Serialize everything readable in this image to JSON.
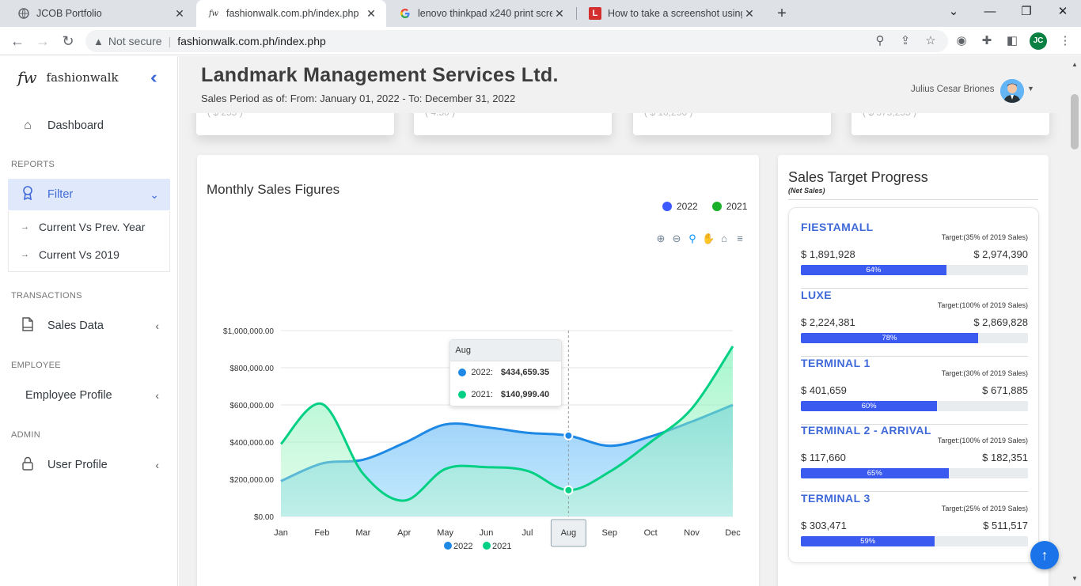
{
  "browser": {
    "tabs": [
      {
        "title": "JCOB Portfolio",
        "close": "✕"
      },
      {
        "title": "fashionwalk.com.ph/index.php",
        "close": "✕"
      },
      {
        "title": "lenovo thinkpad x240 print scree",
        "close": "✕"
      },
      {
        "title": "How to take a screenshot using t",
        "close": "✕"
      }
    ],
    "security_label": "Not secure",
    "url": "fashionwalk.com.ph/index.php",
    "profile_initials": "JC"
  },
  "sidebar": {
    "brand_logo": "fw",
    "brand_name": "fashionwalk",
    "dashboard": "Dashboard",
    "section_reports": "REPORTS",
    "filter": "Filter",
    "sub_current_prev": "Current Vs Prev. Year",
    "sub_current_2019": "Current Vs 2019",
    "section_transactions": "TRANSACTIONS",
    "sales_data": "Sales Data",
    "section_employee": "EMPLOYEE",
    "employee_profile": "Employee Profile",
    "section_admin": "ADMIN",
    "user_profile": "User Profile"
  },
  "header": {
    "company": "Landmark Management Services Ltd.",
    "period": "Sales Period as of: From: January 01, 2022 - To: December 31, 2022",
    "user_name": "Julius Cesar Briones"
  },
  "top_cards": [
    "( $ 255 )",
    "( 4.50 )",
    "( $ 10,256 )",
    "( $ 375,255 )"
  ],
  "chart_title": "Monthly Sales Figures",
  "chart_data": {
    "type": "area",
    "title": "Monthly Sales Figures",
    "categories": [
      "Jan",
      "Feb",
      "Mar",
      "Apr",
      "May",
      "Jun",
      "Jul",
      "Aug",
      "Sep",
      "Oct",
      "Nov",
      "Dec"
    ],
    "y_ticks": [
      "$1,000,000.00",
      "$800,000.00",
      "$600,000.00",
      "$400,000.00",
      "$200,000.00",
      "$0.00"
    ],
    "ylim": [
      0,
      1000000
    ],
    "series": [
      {
        "name": "2022",
        "color": "#1e88e5",
        "values": [
          190000,
          285000,
          305000,
          395000,
          495000,
          480000,
          450000,
          434659.35,
          380000,
          430000,
          510000,
          600000
        ]
      },
      {
        "name": "2021",
        "color": "#00d084",
        "values": [
          390000,
          605000,
          230000,
          85000,
          255000,
          265000,
          245000,
          140999.4,
          240000,
          400000,
          580000,
          915000
        ]
      }
    ],
    "legend_position": "top-right",
    "grid": true,
    "tooltip": {
      "title": "Aug",
      "rows": [
        {
          "label": "2022:",
          "value": "$434,659.35"
        },
        {
          "label": "2021:",
          "value": "$140,999.40"
        }
      ]
    }
  },
  "legend": {
    "s1": "2022",
    "s2": "2021"
  },
  "target": {
    "title": "Sales Target Progress",
    "subtitle": "(Net Sales)",
    "stores": [
      {
        "name": "FIESTAMALL",
        "target_label": "Target:(35% of 2019 Sales)",
        "actual": "$ 1,891,928",
        "goal": "$ 2,974,390",
        "percent_label": "64%",
        "percent": 64
      },
      {
        "name": "LUXE",
        "target_label": "Target:(100% of 2019 Sales)",
        "actual": "$ 2,224,381",
        "goal": "$ 2,869,828",
        "percent_label": "78%",
        "percent": 78
      },
      {
        "name": "TERMINAL 1",
        "target_label": "Target:(30% of 2019 Sales)",
        "actual": "$ 401,659",
        "goal": "$ 671,885",
        "percent_label": "60%",
        "percent": 60
      },
      {
        "name": "TERMINAL 2 - ARRIVAL",
        "target_label": "Target:(100% of 2019 Sales)",
        "actual": "$ 117,660",
        "goal": "$ 182,351",
        "percent_label": "65%",
        "percent": 65
      },
      {
        "name": "TERMINAL 3",
        "target_label": "Target:(25% of 2019 Sales)",
        "actual": "$ 303,471",
        "goal": "$ 511,517",
        "percent_label": "59%",
        "percent": 59
      }
    ]
  },
  "colors": {
    "accent": "#3f6ad8",
    "progress": "#3a5af0",
    "series_2022": "#1e88e5",
    "series_2021": "#00d084"
  }
}
